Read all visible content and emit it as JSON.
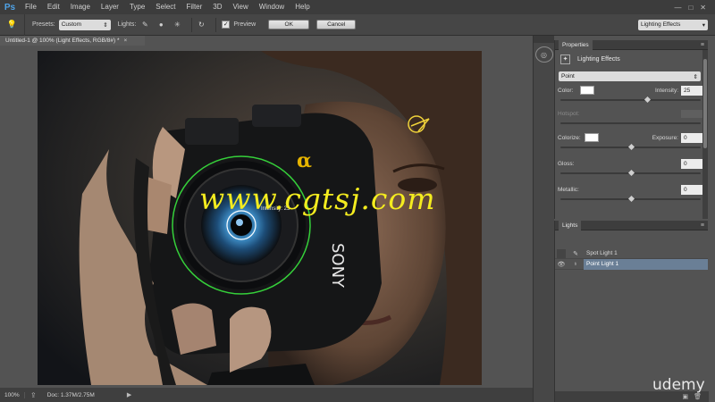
{
  "app": {
    "logo": "Ps"
  },
  "menu": [
    "File",
    "Edit",
    "Image",
    "Layer",
    "Type",
    "Select",
    "Filter",
    "3D",
    "View",
    "Window",
    "Help"
  ],
  "window_controls": {
    "min": "—",
    "max": "□",
    "close": "✕"
  },
  "options": {
    "presets_label": "Presets:",
    "presets_value": "Custom",
    "lights_label": "Lights:",
    "preview_label": "Preview",
    "preview_checked": true,
    "ok": "OK",
    "cancel": "Cancel",
    "workspace": "Lighting Effects"
  },
  "document": {
    "tab_title": "Untitled-1 @ 100% (Light Effects, RGB/8#) *",
    "close": "×",
    "light_info_label": "Intensity: 25"
  },
  "status": {
    "zoom": "100%",
    "doc": "Doc: 1.37M/2.75M"
  },
  "properties": {
    "tab": "Properties",
    "title": "Lighting Effects",
    "light_type": "Point",
    "color_label": "Color:",
    "color_value": "#ffffff",
    "intensity_label": "Intensity:",
    "intensity": "25",
    "intensity_level": 0.62,
    "hotspot_label": "Hotspot:",
    "colorize_label": "Colorize:",
    "exposure_label": "Exposure:",
    "exposure": "0",
    "exposure_level": 0.5,
    "gloss_label": "Gloss:",
    "gloss": "0",
    "gloss_level": 0.5,
    "metallic_label": "Metallic:",
    "metallic": "0",
    "metallic_level": 0.5
  },
  "lights_panel": {
    "tab": "Lights",
    "items": [
      {
        "name": "Spot Light 1",
        "visible": false,
        "selected": false
      },
      {
        "name": "Point Light 1",
        "visible": true,
        "selected": true
      }
    ]
  },
  "watermark": "www.cgtsj.com",
  "brand": "udemy"
}
